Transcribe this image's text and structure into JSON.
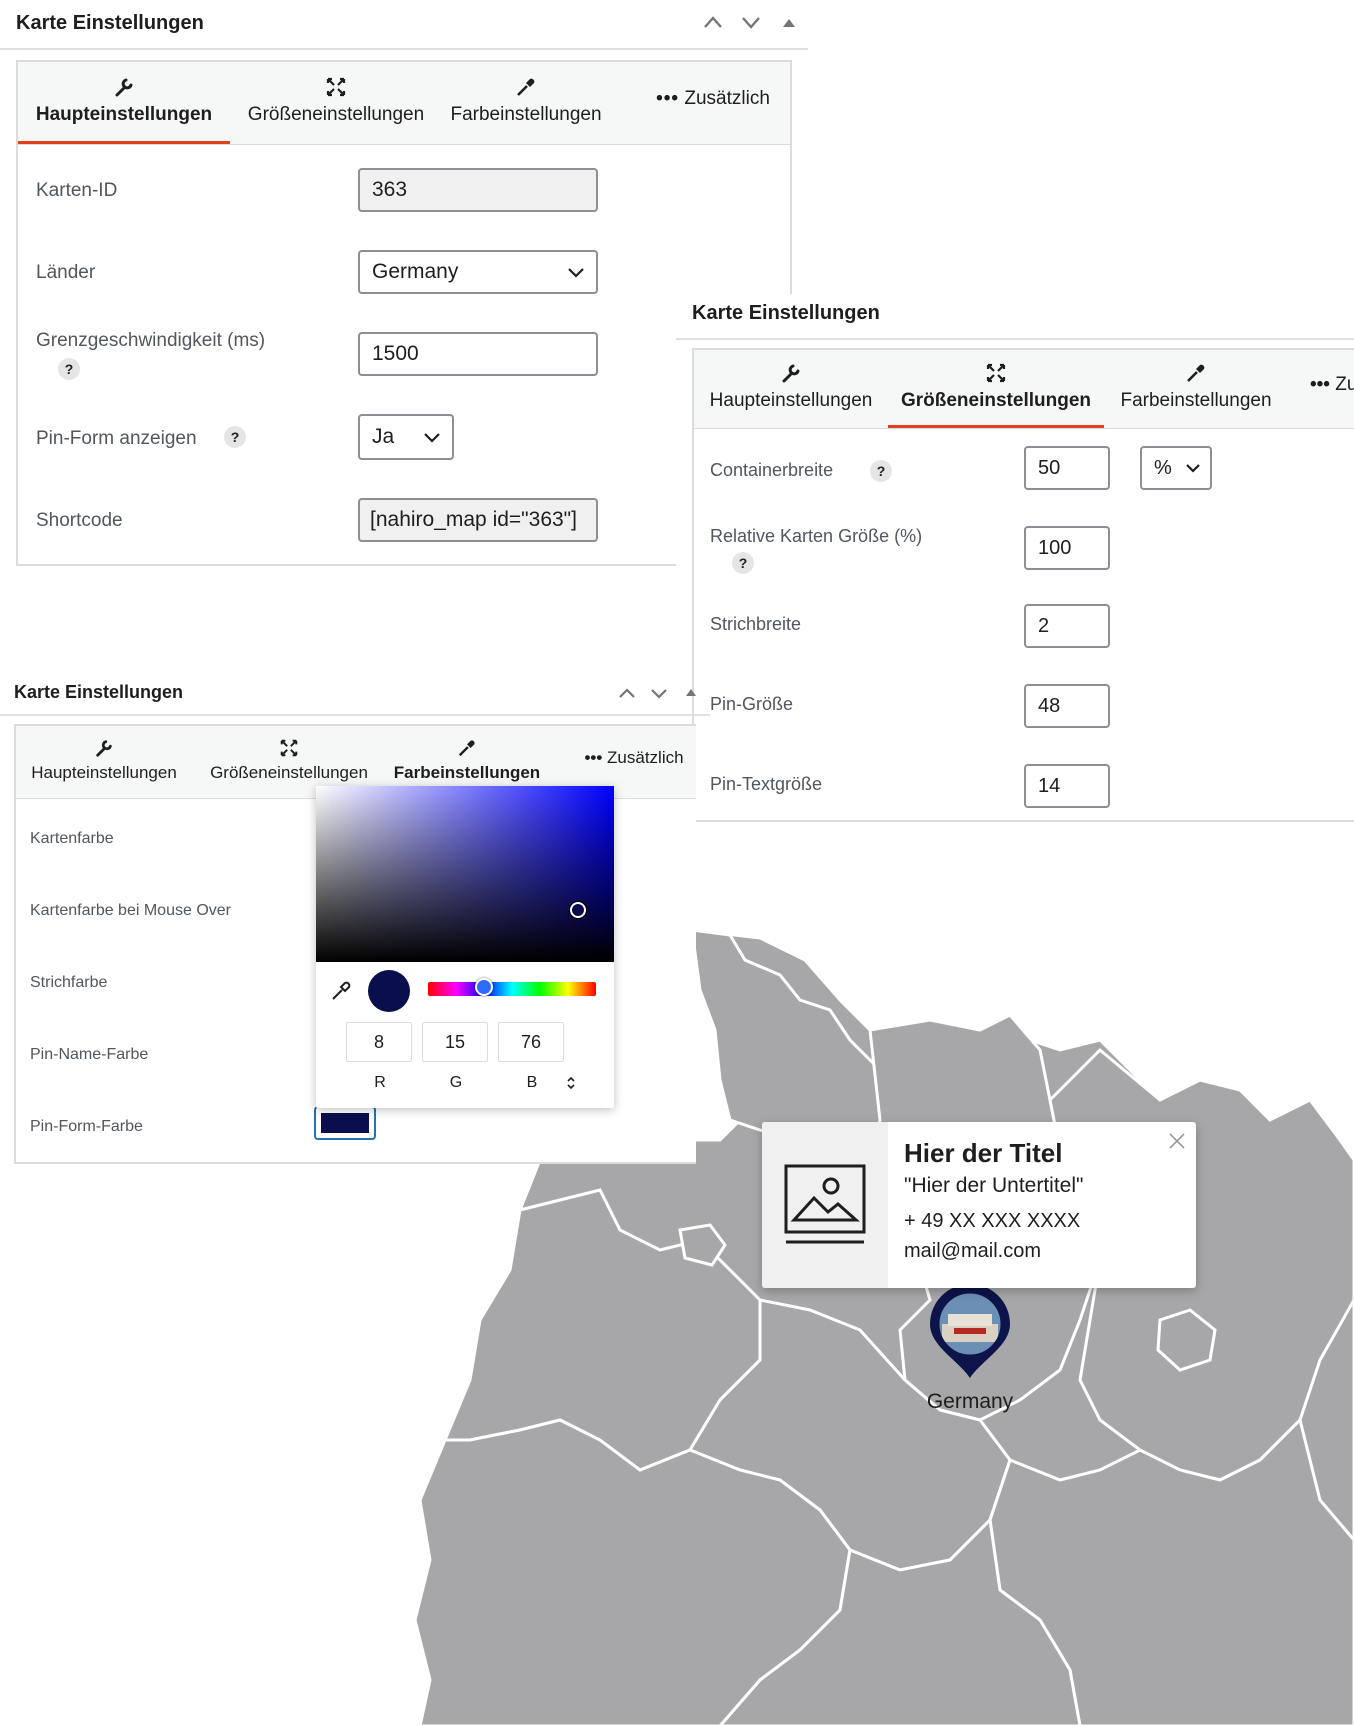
{
  "panel1": {
    "title": "Karte Einstellungen",
    "tabs": [
      {
        "label": "Haupteinstellungen",
        "icon": "wrench-icon"
      },
      {
        "label": "Größeneinstellungen",
        "icon": "resize-icon"
      },
      {
        "label": "Farbeinstellungen",
        "icon": "eyedropper-icon"
      },
      {
        "label": "Zusätzlich",
        "icon": "more-dots-icon"
      }
    ],
    "active_tab": "Haupteinstellungen",
    "fields": {
      "map_id": {
        "label": "Karten-ID",
        "value": "363"
      },
      "countries": {
        "label": "Länder",
        "value": "Germany"
      },
      "speed": {
        "label": "Grenzgeschwindigkeit (ms)",
        "value": "1500"
      },
      "pin_shape": {
        "label": "Pin-Form anzeigen",
        "value": "Ja"
      },
      "shortcode": {
        "label": "Shortcode",
        "value": "[nahiro_map id=\"363\"]"
      }
    }
  },
  "panel2": {
    "title": "Karte Einstellungen",
    "tabs": [
      {
        "label": "Haupteinstellungen",
        "icon": "wrench-icon"
      },
      {
        "label": "Größeneinstellungen",
        "icon": "resize-icon"
      },
      {
        "label": "Farbeinstellungen",
        "icon": "eyedropper-icon"
      },
      {
        "label": "Zu",
        "icon": "more-dots-icon"
      }
    ],
    "active_tab": "Größeneinstellungen",
    "fields": {
      "container_width": {
        "label": "Containerbreite",
        "value": "50",
        "unit": "%"
      },
      "relative_size": {
        "label": "Relative Karten Größe (%)",
        "value": "100"
      },
      "stroke_width": {
        "label": "Strichbreite",
        "value": "2"
      },
      "pin_size": {
        "label": "Pin-Größe",
        "value": "48"
      },
      "pin_text_size": {
        "label": "Pin-Textgröße",
        "value": "14"
      }
    }
  },
  "panel3": {
    "title": "Karte Einstellungen",
    "tabs": [
      {
        "label": "Haupteinstellungen",
        "icon": "wrench-icon"
      },
      {
        "label": "Größeneinstellungen",
        "icon": "resize-icon"
      },
      {
        "label": "Farbeinstellungen",
        "icon": "eyedropper-icon"
      },
      {
        "label": "Zusätzlich",
        "icon": "more-dots-icon"
      }
    ],
    "active_tab": "Farbeinstellungen",
    "fields": {
      "map_color": {
        "label": "Kartenfarbe"
      },
      "map_hover_color": {
        "label": "Kartenfarbe bei Mouse Over"
      },
      "stroke_color": {
        "label": "Strichfarbe"
      },
      "pin_name_color": {
        "label": "Pin-Name-Farbe"
      },
      "pin_shape_color": {
        "label": "Pin-Form-Farbe",
        "color": "#080f4c"
      }
    }
  },
  "color_picker": {
    "r": "8",
    "g": "15",
    "b": "76",
    "r_label": "R",
    "g_label": "G",
    "b_label": "B",
    "current_color": "#080f4c",
    "hue": "#0000ff"
  },
  "map": {
    "region_color": "#a7a7a9",
    "border_color": "#ffffff",
    "pin_label": "Germany",
    "pin_color": "#0c1449",
    "popup": {
      "title": "Hier der Titel",
      "subtitle": "\"Hier der Untertitel\"",
      "phone": "+ 49 XX XXX XXXX",
      "email": "mail@mail.com"
    }
  },
  "colors": {
    "accent": "#e2401c",
    "field_border": "#8c8f94"
  }
}
